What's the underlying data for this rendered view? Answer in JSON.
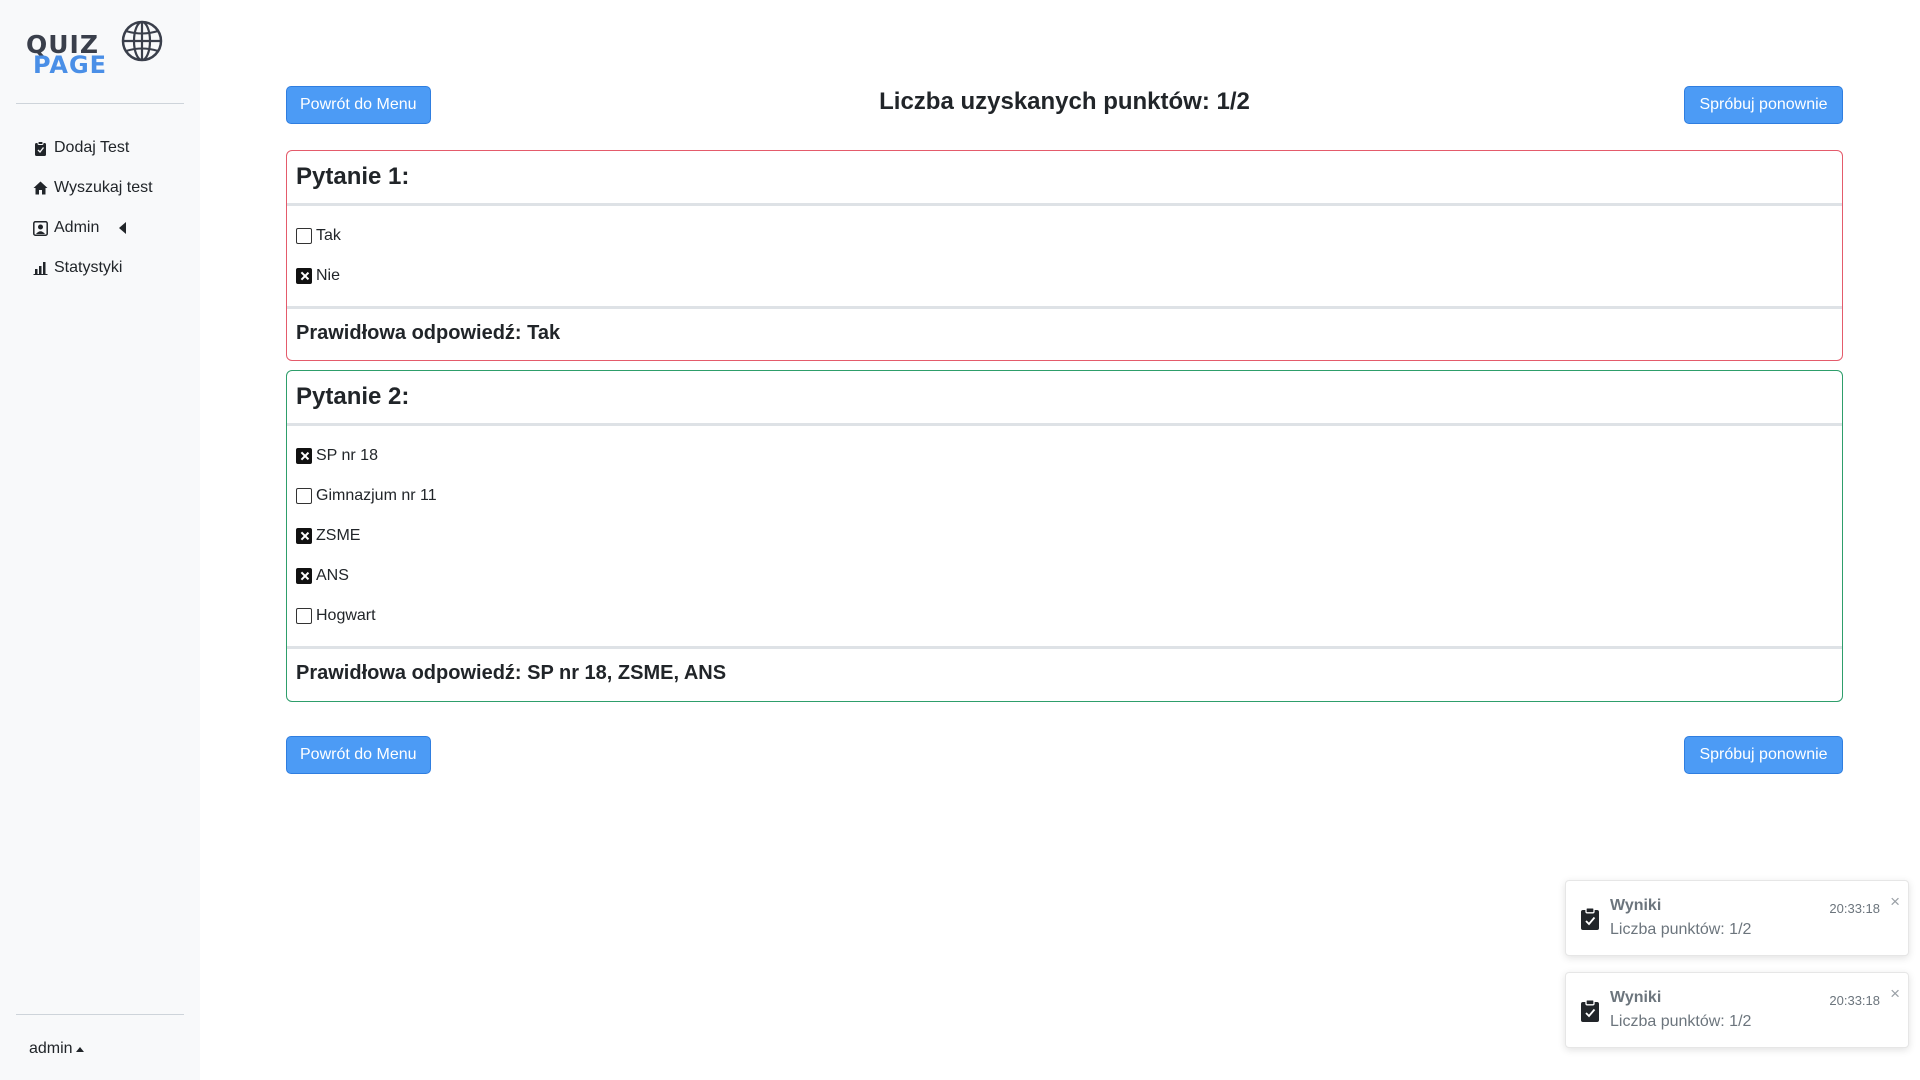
{
  "brand": {
    "line1": "QUIZ",
    "line2": "PAGE"
  },
  "sidebar": {
    "items": [
      {
        "label": "Dodaj Test",
        "icon": "clipboard-icon"
      },
      {
        "label": "Wyszukaj test",
        "icon": "house-icon"
      },
      {
        "label": "Admin",
        "icon": "person-badge-icon"
      },
      {
        "label": "Statystyki",
        "icon": "bar-chart-icon"
      }
    ],
    "user": "admin"
  },
  "results": {
    "score_text": "Liczba uzyskanych punktów: 1/2",
    "back_label": "Powrót do Menu",
    "retry_label": "Spróbuj ponownie"
  },
  "questions": [
    {
      "title": "Pytanie 1:",
      "result": "wrong",
      "options": [
        {
          "label": "Tak",
          "checked": false
        },
        {
          "label": "Nie",
          "checked": true
        }
      ],
      "correct_text": "Prawidłowa odpowiedź: Tak"
    },
    {
      "title": "Pytanie 2:",
      "result": "correct",
      "options": [
        {
          "label": "SP nr 18",
          "checked": true
        },
        {
          "label": "Gimnazjum nr 11",
          "checked": false
        },
        {
          "label": "ZSME",
          "checked": true
        },
        {
          "label": "ANS",
          "checked": true
        },
        {
          "label": "Hogwart",
          "checked": false
        }
      ],
      "correct_text": "Prawidłowa odpowiedź: SP nr 18, ZSME, ANS"
    }
  ],
  "toasts": [
    {
      "title": "Wyniki",
      "time": "20:33:18",
      "message": "Liczba punktów: 1/2",
      "close": "×"
    },
    {
      "title": "Wyniki",
      "time": "20:33:18",
      "message": "Liczba punktów: 1/2",
      "close": "×"
    }
  ],
  "colors": {
    "primary": "#4c9bf5",
    "wrong_border": "#e45b6b",
    "correct_border": "#2e9e6b",
    "sidebar_bg": "#f8f9fa"
  }
}
